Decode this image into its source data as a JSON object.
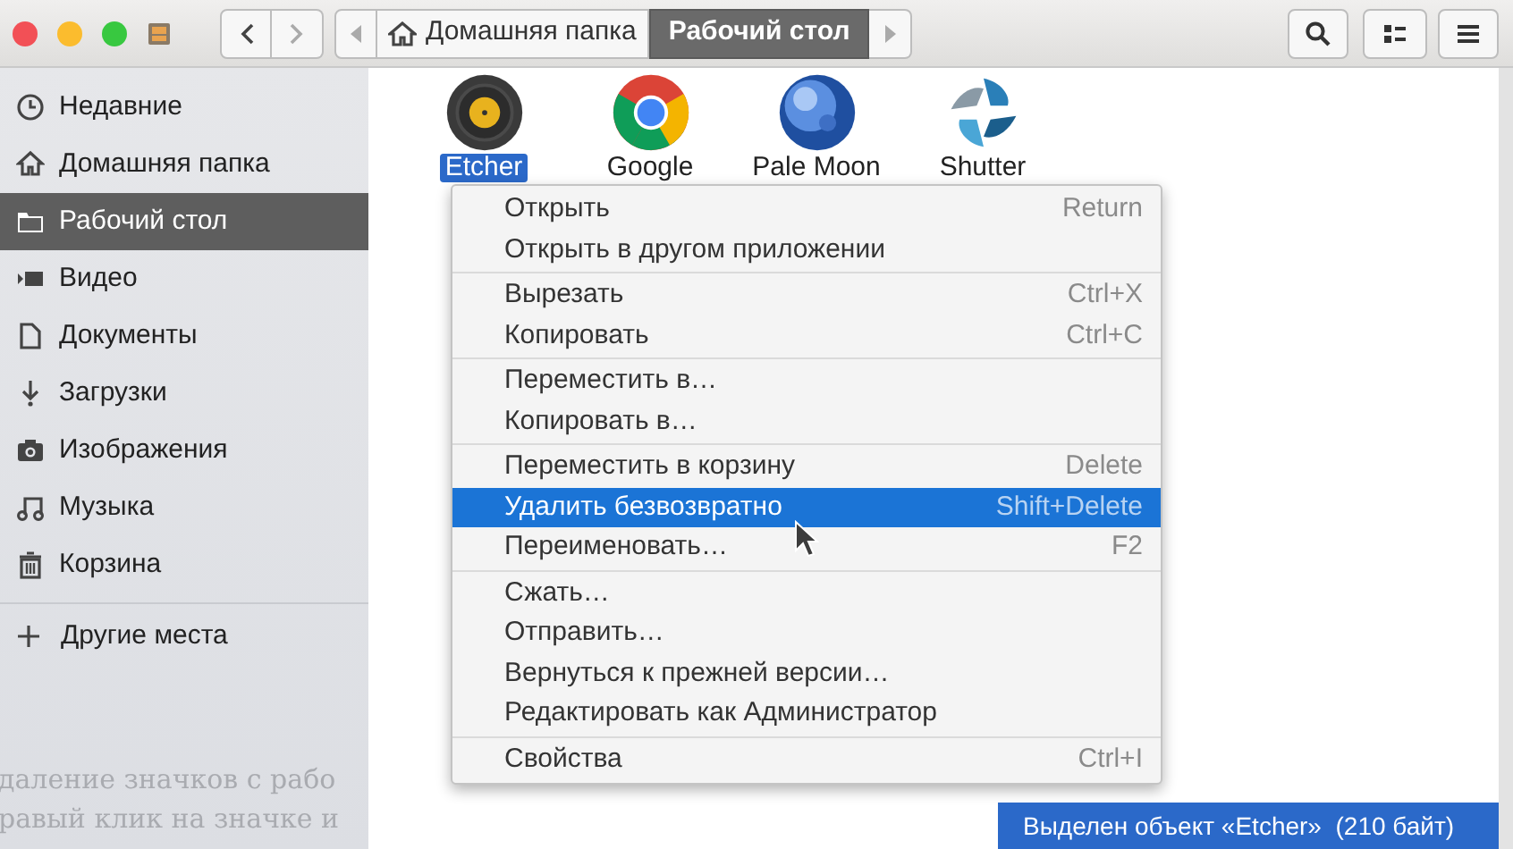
{
  "path_bar": {
    "segments": [
      {
        "label": "Домашняя папка",
        "selected": false
      },
      {
        "label": "Рабочий стол",
        "selected": true
      }
    ]
  },
  "sidebar": {
    "items": [
      {
        "label": "Недавние",
        "selected": false
      },
      {
        "label": "Домашняя папка",
        "selected": false
      },
      {
        "label": "Рабочий стол",
        "selected": true
      },
      {
        "label": "Видео",
        "selected": false
      },
      {
        "label": "Документы",
        "selected": false
      },
      {
        "label": "Загрузки",
        "selected": false
      },
      {
        "label": "Изображения",
        "selected": false
      },
      {
        "label": "Музыка",
        "selected": false
      },
      {
        "label": "Корзина",
        "selected": false
      }
    ],
    "other_places": "Другие места"
  },
  "background_text": [
    "даление значков с рабо",
    "равый клик на значке и"
  ],
  "files": [
    {
      "label": "Etcher",
      "selected": true
    },
    {
      "label": "Google",
      "selected": false
    },
    {
      "label": "Pale Moon",
      "selected": false
    },
    {
      "label": "Shutter",
      "selected": false
    }
  ],
  "context_menu": {
    "groups": [
      [
        {
          "label": "Открыть",
          "shortcut": "Return",
          "selected": false
        },
        {
          "label": "Открыть в другом приложении",
          "selected": false
        }
      ],
      [
        {
          "label": "Вырезать",
          "shortcut": "Ctrl+X",
          "selected": false
        },
        {
          "label": "Копировать",
          "shortcut": "Ctrl+C",
          "selected": false
        }
      ],
      [
        {
          "label": "Переместить в…",
          "selected": false
        },
        {
          "label": "Копировать в…",
          "selected": false
        }
      ],
      [
        {
          "label": "Переместить в корзину",
          "shortcut": "Delete",
          "selected": false
        },
        {
          "label": "Удалить безвозвратно",
          "shortcut": "Shift+Delete",
          "selected": true
        },
        {
          "label": "Переименовать…",
          "shortcut": "F2",
          "selected": false
        }
      ],
      [
        {
          "label": "Сжать…",
          "selected": false
        },
        {
          "label": "Отправить…",
          "selected": false
        },
        {
          "label": "Вернуться к прежней версии…",
          "selected": false
        },
        {
          "label": "Редактировать как Администратор",
          "selected": false
        }
      ],
      [
        {
          "label": "Свойства",
          "shortcut": "Ctrl+I",
          "selected": false
        }
      ]
    ]
  },
  "status_bar": {
    "text": "Выделен объект «Etcher»  (210 байт)"
  }
}
